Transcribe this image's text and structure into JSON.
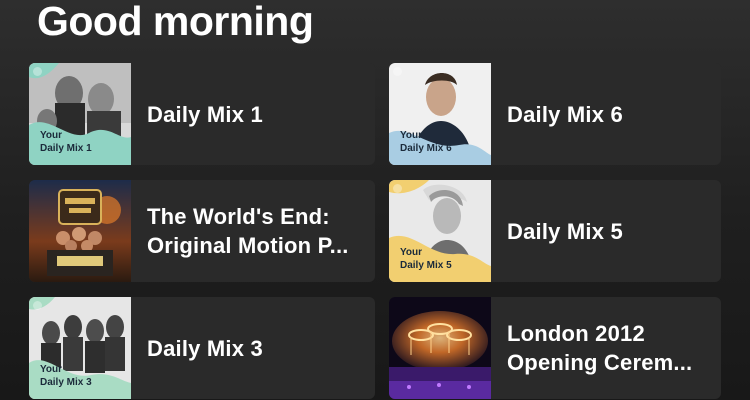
{
  "greeting": "Good morning",
  "shortcuts": [
    {
      "title": "Daily Mix 1",
      "cover_tag": [
        "Your",
        "Daily Mix 1"
      ],
      "cover_color": "#8fd3c3"
    },
    {
      "title": "Daily Mix 6",
      "cover_tag": [
        "Your",
        "Daily Mix 6"
      ],
      "cover_color": "#a9cde3"
    },
    {
      "title": "The World's End:\nOriginal Motion P...",
      "cover_icon": "movie-poster-artwork"
    },
    {
      "title": "Daily Mix 5",
      "cover_tag": [
        "Your",
        "Daily Mix 5"
      ],
      "cover_color": "#f2cf70"
    },
    {
      "title": "Daily Mix 3",
      "cover_tag": [
        "Your",
        "Daily Mix 3"
      ],
      "cover_color": "#a9dcc4"
    },
    {
      "title": "London 2012\nOpening Cerem...",
      "cover_icon": "stadium-fireworks-artwork"
    }
  ],
  "colors": {
    "background": "#1a1a1a",
    "card": "#2a2a2a",
    "text": "#ffffff"
  }
}
